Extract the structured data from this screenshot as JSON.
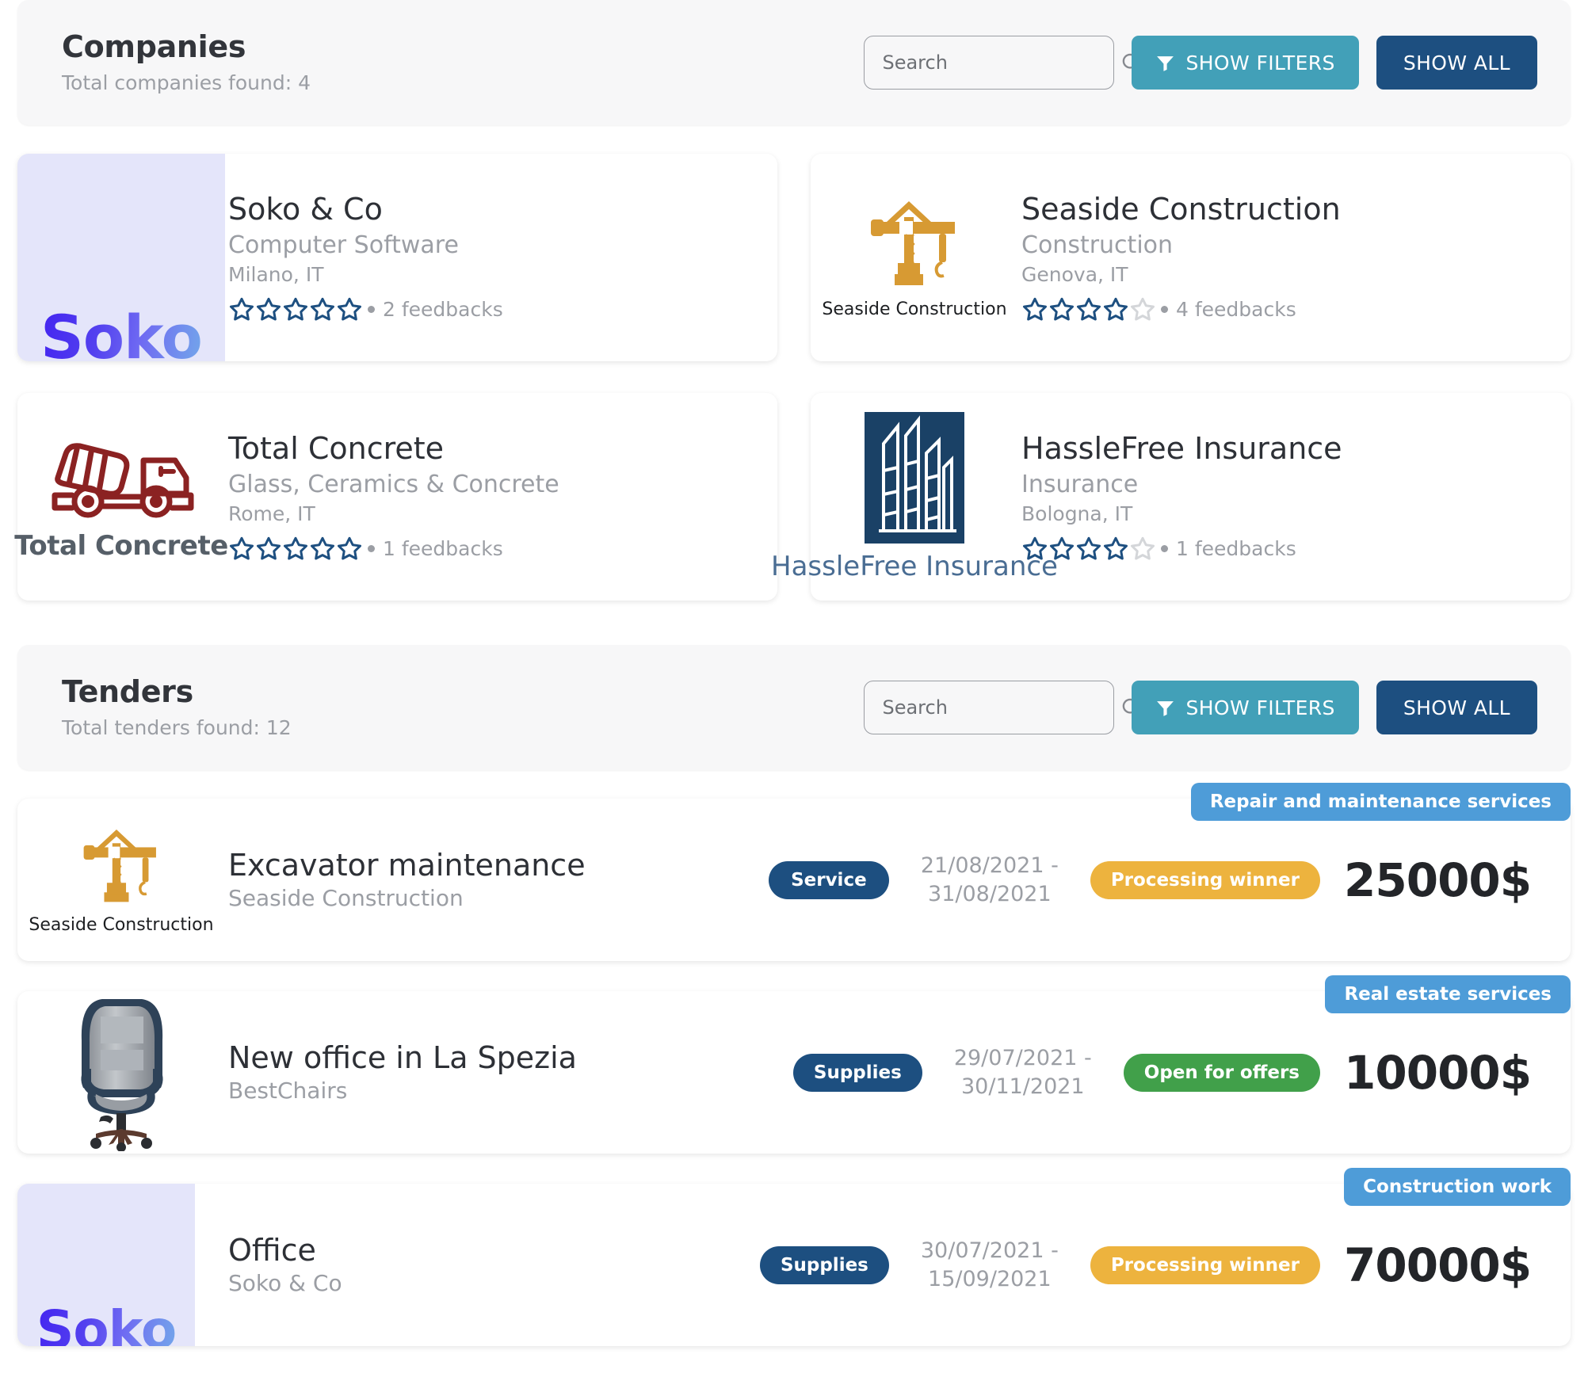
{
  "companies_section": {
    "title": "Companies",
    "subtitle": "Total companies found: 4",
    "search": {
      "placeholder": "Search",
      "value": ""
    },
    "show_filters_label": "SHOW FILTERS",
    "show_all_label": "SHOW ALL",
    "colors": {
      "filters": "#42a0b8",
      "show_all": "#1d4f80"
    },
    "items": [
      {
        "name": "Soko & Co",
        "industry": "Computer Software",
        "city": "Milano, IT",
        "logo_kind": "soko-wordmark",
        "logo_text": "Soko",
        "stars_filled": 5,
        "stars_total": 5,
        "feedbacks": "2 feedbacks"
      },
      {
        "name": "Seaside Construction",
        "industry": "Construction",
        "city": "Genova, IT",
        "logo_kind": "crane",
        "logo_text": "Seaside Construction",
        "stars_filled": 4,
        "stars_total": 5,
        "feedbacks": "4 feedbacks"
      },
      {
        "name": "Total Concrete",
        "industry": "Glass, Ceramics & Concrete",
        "city": "Rome, IT",
        "logo_kind": "mixer-truck",
        "logo_text": "Total Concrete",
        "stars_filled": 5,
        "stars_total": 5,
        "feedbacks": "1 feedbacks"
      },
      {
        "name": "HassleFree Insurance",
        "industry": "Insurance",
        "city": "Bologna, IT",
        "logo_kind": "building",
        "logo_text": "HassleFree Insurance",
        "stars_filled": 4,
        "stars_total": 5,
        "feedbacks": "1 feedbacks"
      }
    ]
  },
  "tenders_section": {
    "title": "Tenders",
    "subtitle": "Total tenders found: 12",
    "search": {
      "placeholder": "Search",
      "value": ""
    },
    "show_filters_label": "SHOW FILTERS",
    "show_all_label": "SHOW ALL",
    "items": [
      {
        "title": "Excavator maintenance",
        "company": "Seaside Construction",
        "logo_kind": "crane",
        "logo_text": "Seaside Construction",
        "type": "Service",
        "date_from": "21/08/2021 -",
        "date_to": "31/08/2021",
        "status": "Processing winner",
        "status_color": "#edb33e",
        "price": "25000$",
        "category": "Repair and maintenance services"
      },
      {
        "title": "New office in La Spezia",
        "company": "BestChairs",
        "logo_kind": "office-chair",
        "logo_text": "",
        "type": "Supplies",
        "date_from": "29/07/2021 -",
        "date_to": "30/11/2021",
        "status": "Open for offers",
        "status_color": "#41a04a",
        "price": "10000$",
        "category": "Real estate services"
      },
      {
        "title": "Office",
        "company": "Soko & Co",
        "logo_kind": "soko-wordmark",
        "logo_text": "Soko",
        "type": "Supplies",
        "date_from": "30/07/2021 -",
        "date_to": "15/09/2021",
        "status": "Processing winner",
        "status_color": "#edb33e",
        "price": "70000$",
        "category": "Construction work"
      }
    ]
  }
}
